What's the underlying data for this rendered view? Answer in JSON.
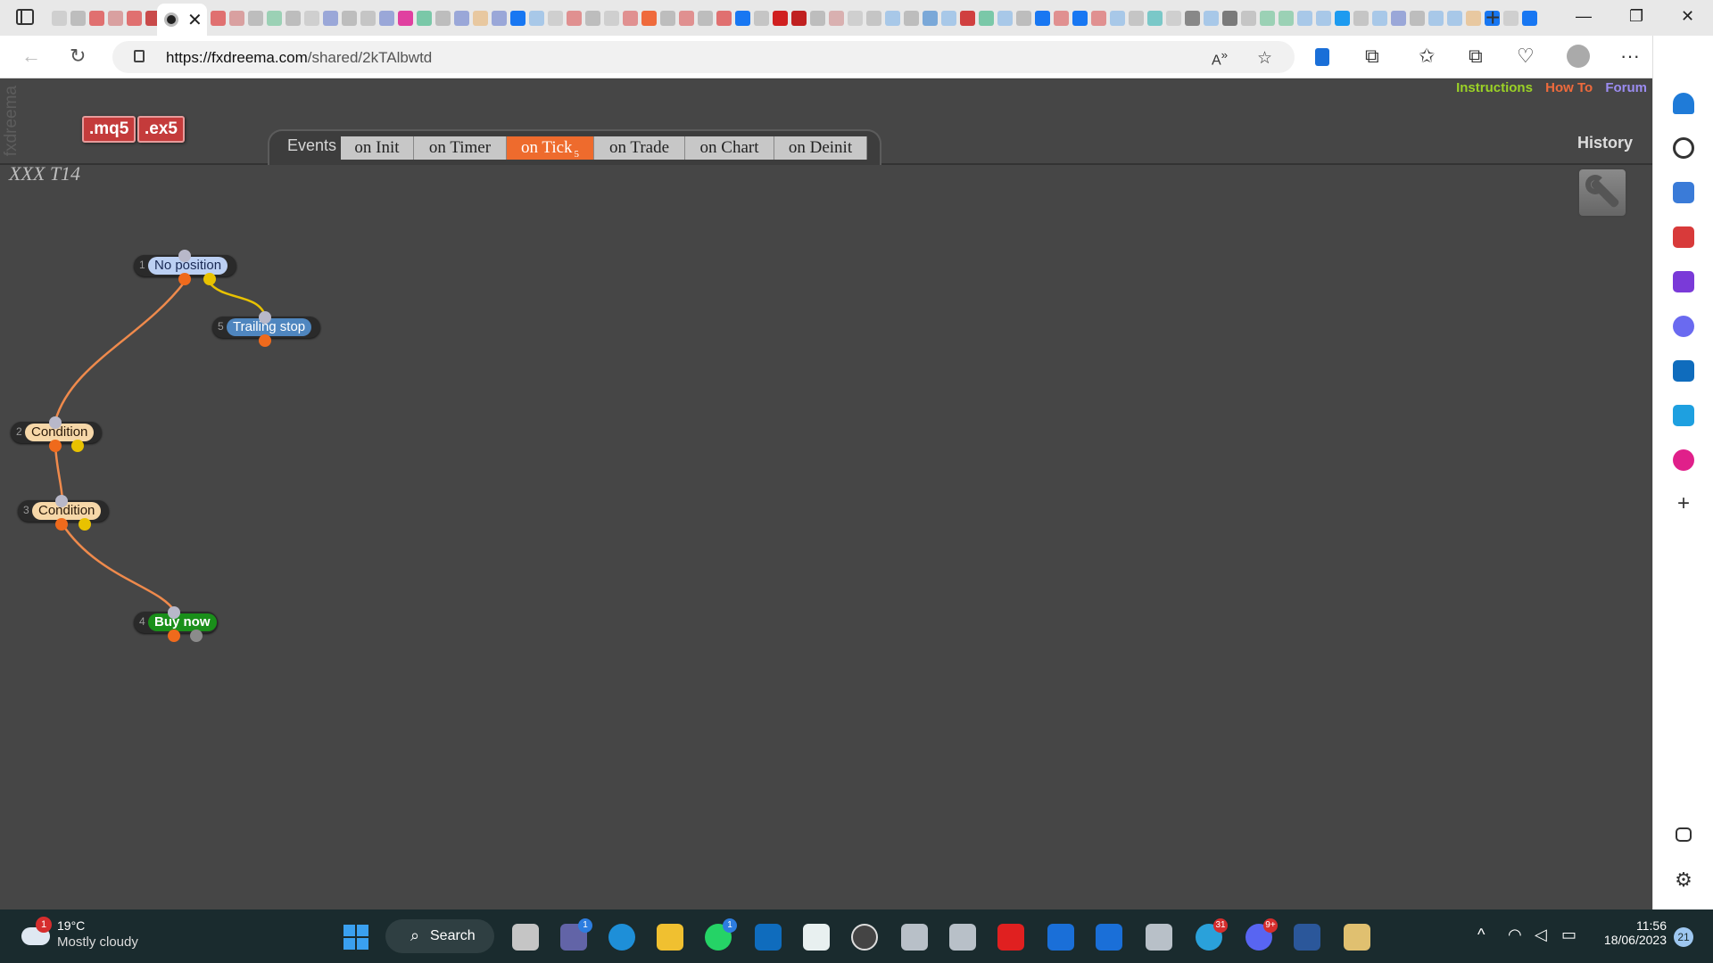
{
  "browser": {
    "url_domain": "https://fxdreema.com",
    "url_path": "/shared/2kTAlbwtd"
  },
  "app": {
    "watermark": "fxdreema",
    "buttons": {
      "mq5": ".mq5",
      "ex5": ".ex5"
    },
    "links": {
      "instructions": "Instructions",
      "howto": "How To",
      "forum": "Forum"
    },
    "events_label": "Events",
    "tabs": [
      {
        "label": "on Init"
      },
      {
        "label": "on Timer"
      },
      {
        "label": "on Tick",
        "count": "5"
      },
      {
        "label": "on Trade"
      },
      {
        "label": "on Chart"
      },
      {
        "label": "on Deinit"
      }
    ],
    "history": "History",
    "project_title": "XXX T14",
    "colors": {
      "active_tab": "#ee6b2d",
      "canvas": "#464646",
      "link_instructions": "#9bd226",
      "link_howto": "#ef6a3c",
      "link_forum": "#9b8cf0"
    },
    "nodes": [
      {
        "num": "1",
        "label": "No position"
      },
      {
        "num": "5",
        "label": "Trailing stop"
      },
      {
        "num": "2",
        "label": "Condition"
      },
      {
        "num": "3",
        "label": "Condition"
      },
      {
        "num": "4",
        "label": "Buy now"
      }
    ]
  },
  "taskbar": {
    "weather_temp": "19°C",
    "weather_desc": "Mostly cloudy",
    "weather_badge": "1",
    "search": "Search",
    "badges": {
      "teams": "1",
      "whatsapp": "1",
      "telegram": "31",
      "discord": "9+"
    },
    "time": "11:56",
    "date": "18/06/2023",
    "notifications": "21"
  }
}
